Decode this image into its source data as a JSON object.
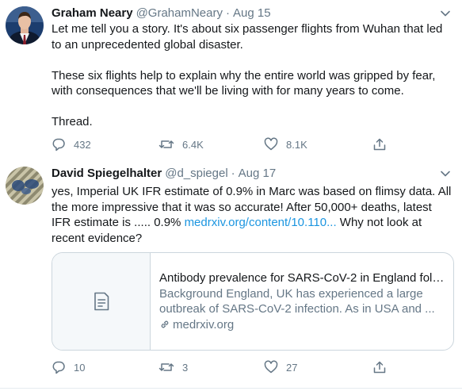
{
  "colors": {
    "accent": "#1b95e0",
    "muted": "#657786",
    "text": "#14171a",
    "border": "#ccd6dd"
  },
  "tweets": [
    {
      "name": "Graham Neary",
      "handle": "@GrahamNeary",
      "separator": "·",
      "date": "Aug 15",
      "paragraphs": [
        "Let me tell you a story. It's about six passenger flights from Wuhan that led to an unprecedented global disaster.",
        "These six flights help to explain why the entire world was gripped by fear, with consequences that we'll be living with for many years to come.",
        "Thread."
      ],
      "actions": {
        "replies": "432",
        "retweets": "6.4K",
        "likes": "8.1K"
      }
    },
    {
      "name": "David Spiegelhalter",
      "handle": "@d_spiegel",
      "separator": "·",
      "date": "Aug 17",
      "text_before_link": "yes, Imperial UK IFR estimate of 0.9% in Marc was based on flimsy data.  All the more impressive that it was so accurate! After 50,000+ deaths, latest IFR estimate is ..... 0.9% ",
      "link": "medrxiv.org/content/10.110...",
      "text_after_link": "  Why not look at recent evidence?",
      "card": {
        "title": "Antibody prevalence for SARS-CoV-2 in England foll...",
        "description": "Background England, UK has experienced a large outbreak of SARS-CoV-2 infection. As in USA and ...",
        "domain": "medrxiv.org"
      },
      "actions": {
        "replies": "10",
        "retweets": "3",
        "likes": "27"
      }
    }
  ]
}
